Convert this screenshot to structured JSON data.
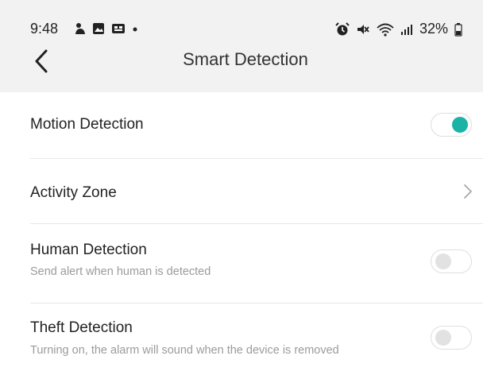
{
  "status_bar": {
    "time": "9:48",
    "left_icons": [
      "notification-icon",
      "image-icon",
      "app-icon",
      "dot-icon"
    ],
    "right_icons": [
      "alarm-icon",
      "mute-icon",
      "wifi-icon",
      "signal-icon",
      "battery-icon"
    ],
    "battery": "32%"
  },
  "header": {
    "title": "Smart Detection",
    "back_icon": "chevron-left-icon"
  },
  "settings": [
    {
      "title": "Motion Detection",
      "subtitle": "",
      "control": "toggle",
      "state": "on"
    },
    {
      "title": "Activity Zone",
      "subtitle": "",
      "control": "chevron",
      "state": ""
    },
    {
      "title": "Human Detection",
      "subtitle": "Send alert when human is detected",
      "control": "toggle",
      "state": "off"
    },
    {
      "title": "Theft Detection",
      "subtitle": "Turning on, the alarm will sound when the device is removed",
      "control": "toggle",
      "state": "off"
    }
  ],
  "colors": {
    "accent": "#1ab3a5",
    "header_bg": "#f2f2f2",
    "divider": "#e7e7e7"
  }
}
